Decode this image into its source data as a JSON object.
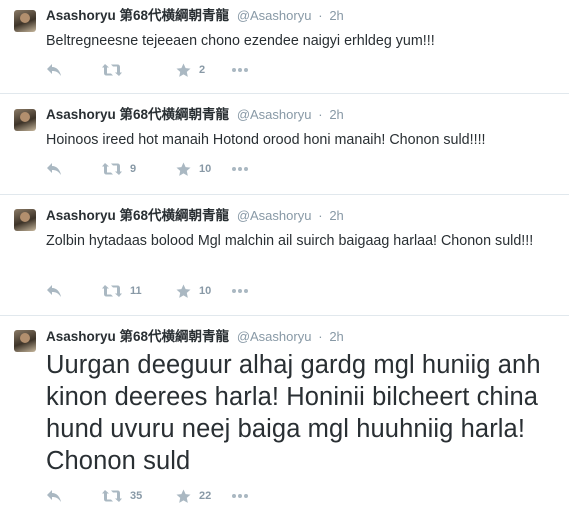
{
  "tweets": [
    {
      "display_name": "Asashoryu 第68代横綱朝青龍",
      "handle": "@Asashoryu",
      "separator": "·",
      "time": "2h",
      "text": "Beltregneesne tejeeaen chono ezendee naigyi erhldeg yum!!!",
      "retweets": "",
      "favorites": "2"
    },
    {
      "display_name": "Asashoryu 第68代横綱朝青龍",
      "handle": "@Asashoryu",
      "separator": "·",
      "time": "2h",
      "text": "Hoinoos ireed hot manaih Hotond orood honi manaih! Chonon suld!!!!",
      "retweets": "9",
      "favorites": "10"
    },
    {
      "display_name": "Asashoryu 第68代横綱朝青龍",
      "handle": "@Asashoryu",
      "separator": "·",
      "time": "2h",
      "text": "Zolbin hytadaas bolood Mgl malchin ail suirch baigaag harlaa! Chonon suld!!!",
      "retweets": "11",
      "favorites": "10"
    },
    {
      "display_name": "Asashoryu 第68代横綱朝青龍",
      "handle": "@Asashoryu",
      "separator": "·",
      "time": "2h",
      "text": "Uurgan deeguur alhaj gardg mgl huniig anh kinon deerees harla! Honinii bilcheert china hund uvuru neej baiga mgl huuhniig harla! Chonon suld",
      "retweets": "35",
      "favorites": "22"
    }
  ],
  "icons": {
    "reply": "reply-icon",
    "retweet": "retweet-icon",
    "favorite": "star-icon",
    "more": "more-icon"
  },
  "colors": {
    "text": "#292f33",
    "muted": "#8899a6",
    "icon": "#aab8c2",
    "divider": "#e1e8ed"
  }
}
